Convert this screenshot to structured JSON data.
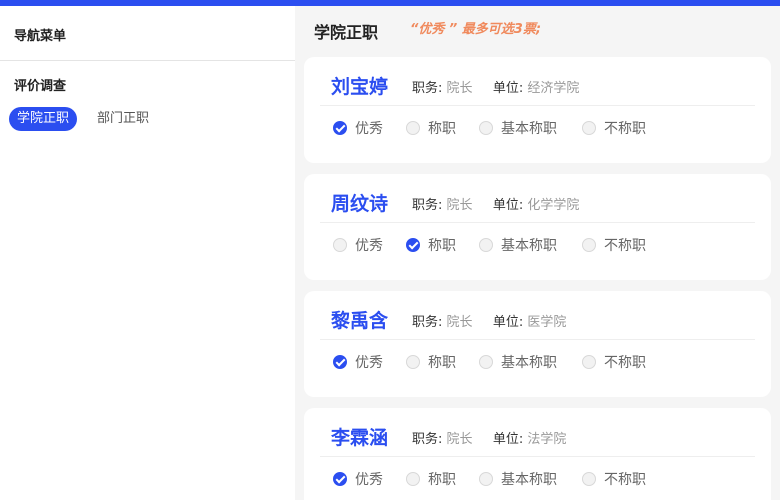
{
  "sidebar": {
    "menu_title": "导航菜单",
    "group_title": "评价调查",
    "items": [
      {
        "label": "学院正职",
        "active": true
      },
      {
        "label": "部门正职",
        "active": false
      }
    ]
  },
  "main": {
    "title": "学院正职",
    "hint": "“优秀 ” 最多可选3票;"
  },
  "labels": {
    "position": "职务:",
    "unit": "单位:"
  },
  "options": [
    "优秀",
    "称职",
    "基本称职",
    "不称职"
  ],
  "candidates": [
    {
      "name": "刘宝婷",
      "position": "院长",
      "unit": "经济学院",
      "selected": "优秀"
    },
    {
      "name": "周纹诗",
      "position": "院长",
      "unit": "化学学院",
      "selected": "称职"
    },
    {
      "name": "黎禹含",
      "position": "院长",
      "unit": "医学院",
      "selected": "优秀"
    },
    {
      "name": "李霖涵",
      "position": "院长",
      "unit": "法学院",
      "selected": "优秀"
    }
  ],
  "colors": {
    "accent": "#2b4ef0",
    "hint": "#f08a5d",
    "background": "#f5f5f5"
  }
}
